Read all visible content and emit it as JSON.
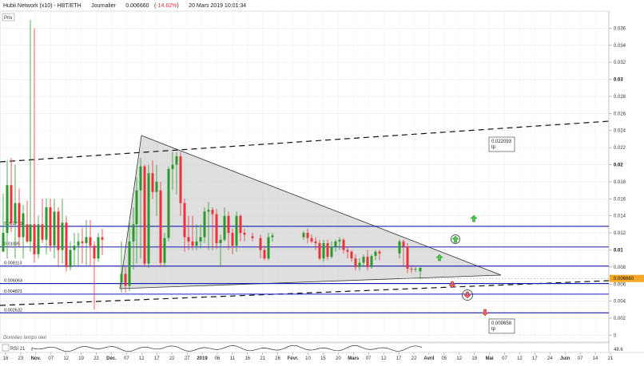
{
  "header": {
    "instrument": "Hubii Network (x10) - HBT/ETH",
    "timeframe": "Journalier",
    "last": "0.006660",
    "change": "-14.62%",
    "datetime": "20 Mars 2019 10:01:34"
  },
  "price_badge": "Prix",
  "realtime_note": "Données temps réel",
  "rsi_label": "RSI 21",
  "colors": {
    "up": "#2a9a2a",
    "down": "#e8333a",
    "level": "#1a1ab8",
    "current": "#f5a623"
  },
  "chart_data": {
    "type": "candlestick",
    "ylim": [
      -0.0008,
      0.038
    ],
    "y_ticks": [
      "0.036",
      "0.034",
      "0.032",
      "0.03",
      "0.028",
      "0.026",
      "0.024",
      "0.022",
      "0.02",
      "0.018",
      "0.016",
      "0.014",
      "0.012",
      "0.01",
      "0.008",
      "0.006",
      "0.004",
      "0.002",
      "0"
    ],
    "y_ticks_bold": [
      "0.03",
      "0.02",
      "0.01"
    ],
    "x_ticks": [
      "18",
      "23",
      "Nov.",
      "07",
      "12",
      "19",
      "22",
      "Déc.",
      "07",
      "12",
      "17",
      "22",
      "27",
      "2019",
      "06",
      "11",
      "16",
      "21",
      "26",
      "Févr.",
      "10",
      "15",
      "20",
      "Mars",
      "07",
      "12",
      "17",
      "22",
      "Avril",
      "05",
      "12",
      "19",
      "Mai",
      "07",
      "12",
      "17",
      "24",
      "Juin",
      "07",
      "14",
      "21"
    ],
    "x_ticks_bold": [
      "Nov.",
      "Déc.",
      "2019",
      "Févr.",
      "Mars",
      "Avril",
      "Mai",
      "Juin"
    ],
    "current_price": "0.006660",
    "levels": [
      {
        "label": "0.012773",
        "value": 0.012773
      },
      {
        "label": "0.01035",
        "value": 0.01035
      },
      {
        "label": "0.008113",
        "value": 0.008113
      },
      {
        "label": "0.006063",
        "value": 0.006063
      },
      {
        "label": "0.004821",
        "value": 0.004821
      },
      {
        "label": "0.002632",
        "value": 0.002632
      }
    ],
    "targets": [
      {
        "label": "0.022093",
        "sub": "tp"
      },
      {
        "label": "0.000658",
        "sub": "tp"
      }
    ],
    "rsi_ticks": [
      "48.6"
    ]
  }
}
